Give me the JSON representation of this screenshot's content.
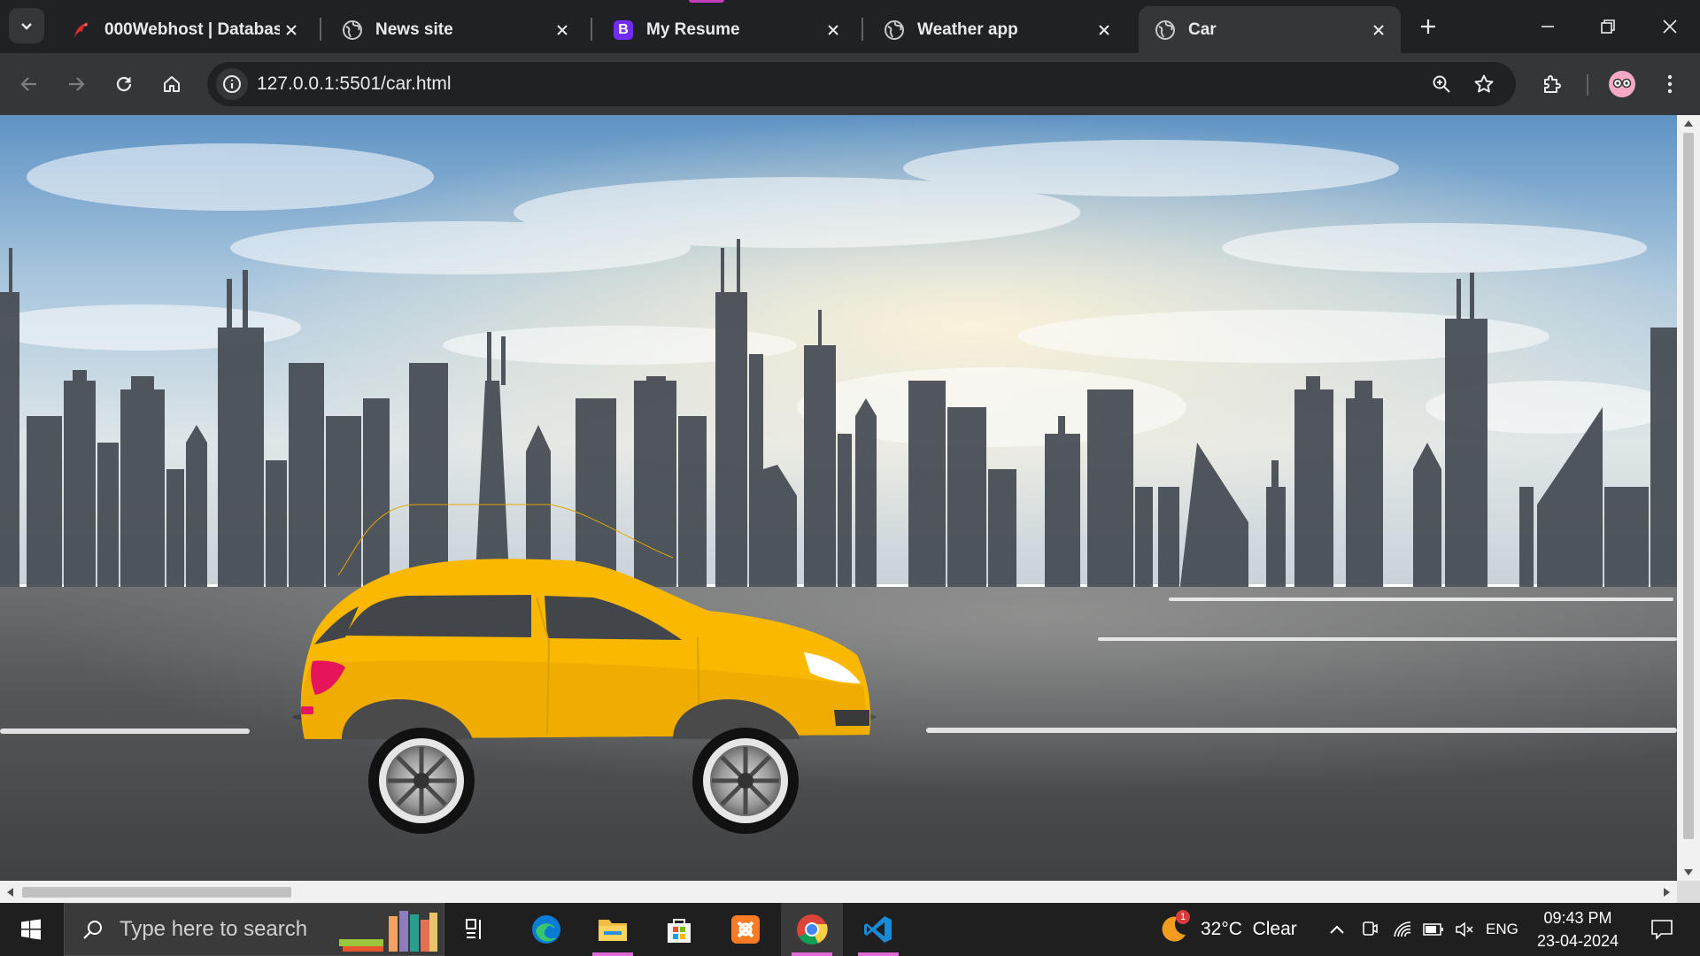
{
  "tabs": [
    {
      "title": "000Webhost | Databases",
      "icon": "webhost-icon",
      "active": false
    },
    {
      "title": "News site",
      "icon": "globe-icon",
      "active": false
    },
    {
      "title": "My Resume",
      "icon": "bootstrap-icon",
      "active": false
    },
    {
      "title": "Weather app",
      "icon": "globe-icon",
      "active": false
    },
    {
      "title": "Car",
      "icon": "globe-icon",
      "active": true
    }
  ],
  "bootstrap_letter": "B",
  "toolbar": {
    "url": "127.0.0.1:5501/car.html"
  },
  "colors": {
    "browser_frame": "#202124",
    "toolbar": "#35363a",
    "car_body": "#fbb800",
    "accent": "#c43dbd"
  },
  "taskbar": {
    "search_placeholder": "Type here to search",
    "weather": "32°C  Clear",
    "weather_badge": "1",
    "language": "ENG",
    "time": "09:43 PM",
    "date": "23-04-2024",
    "apps": [
      "task-view",
      "edge",
      "file-explorer",
      "microsoft-store",
      "xampp",
      "chrome",
      "vs-code"
    ]
  }
}
